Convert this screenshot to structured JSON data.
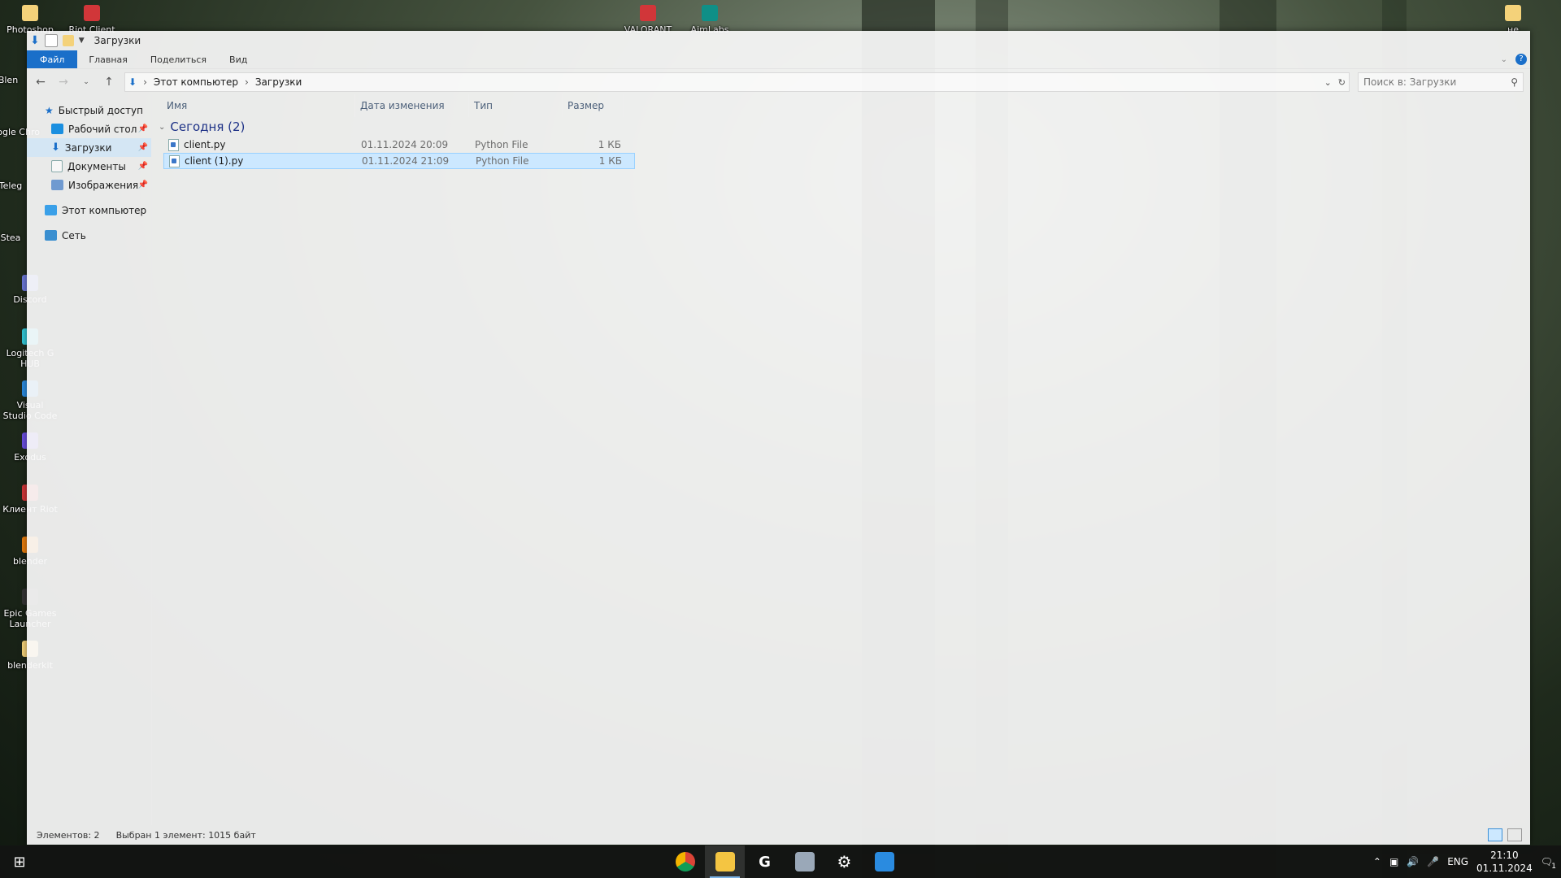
{
  "desktop": {
    "icons_left": [
      "Photoshop",
      "Riot Client",
      "Blen",
      "Google Chro",
      "Teleg",
      "Stea",
      "Discord",
      "Logitech G HUB",
      "Visual Studio Code",
      "Exodus",
      "Клиент Riot",
      "blender",
      "Epic Games Launcher",
      "blenderkit"
    ],
    "icons_top": [
      "VALORANT",
      "AimLabs"
    ],
    "icon_right": "не"
  },
  "window": {
    "title": "Загрузки",
    "ribbon_tabs": [
      "Файл",
      "Главная",
      "Поделиться",
      "Вид"
    ],
    "address": {
      "segments": [
        "Этот компьютер",
        "Загрузки"
      ]
    },
    "search_placeholder": "Поиск в: Загрузки",
    "nav": {
      "quick_access": "Быстрый доступ",
      "items": [
        {
          "label": "Рабочий стол",
          "icon": "desktop-icon"
        },
        {
          "label": "Загрузки",
          "icon": "downloads-icon"
        },
        {
          "label": "Документы",
          "icon": "documents-icon"
        },
        {
          "label": "Изображения",
          "icon": "pictures-icon"
        }
      ],
      "this_pc": "Этот компьютер",
      "network": "Сеть"
    },
    "columns": [
      "Имя",
      "Дата изменения",
      "Тип",
      "Размер"
    ],
    "group_label": "Сегодня (2)",
    "files": [
      {
        "name": "client.py",
        "date": "01.11.2024 20:09",
        "type": "Python File",
        "size": "1 КБ",
        "selected": false
      },
      {
        "name": "client (1).py",
        "date": "01.11.2024 21:09",
        "type": "Python File",
        "size": "1 КБ",
        "selected": true
      }
    ],
    "status": {
      "count": "Элементов: 2",
      "selection": "Выбран 1 элемент: 1015 байт"
    }
  },
  "taskbar": {
    "apps": [
      "chrome-icon",
      "file-explorer-icon",
      "logitech-g-icon",
      "printer-icon",
      "settings-icon",
      "vscode-icon"
    ],
    "lang": "ENG",
    "time": "21:10",
    "date": "01.11.2024",
    "notifications": "1"
  },
  "colors": {
    "accent": "#1a6fc9",
    "selection": "#cce8ff"
  }
}
